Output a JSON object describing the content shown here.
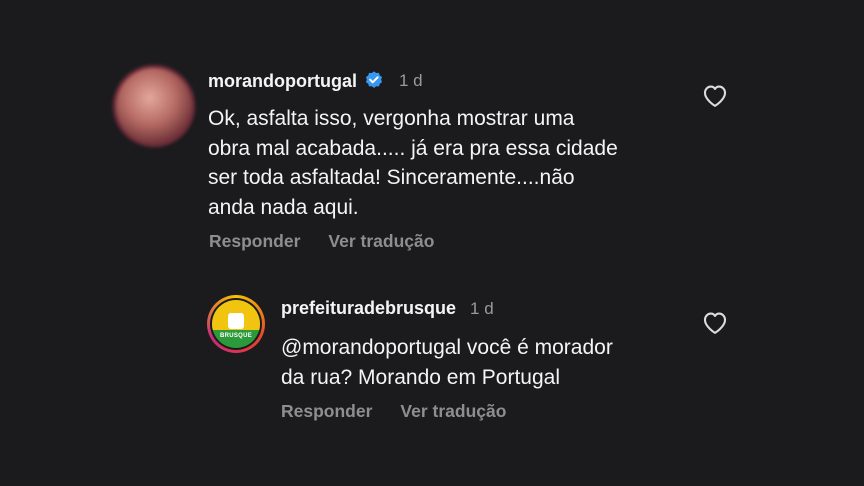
{
  "comments": [
    {
      "username": "morandoportugal",
      "verified": true,
      "time": "1 d",
      "text": "Ok, asfalta isso, vergonha mostrar uma\nobra mal acabada..... já era pra essa cidade\nser toda asfaltada! Sinceramente....não\nanda nada aqui.",
      "reply_label": "Responder",
      "translate_label": "Ver tradução"
    }
  ],
  "replies": [
    {
      "username": "prefeituradebrusque",
      "time": "1 d",
      "avatar_text": "BRUSQUE",
      "text": "@morandoportugal você é morador\nda rua? Morando em Portugal",
      "reply_label": "Responder",
      "translate_label": "Ver tradução"
    }
  ],
  "colors": {
    "background": "#1b1b1d",
    "text": "#f4f4f4",
    "muted": "#8e8e8e",
    "verified": "#3897f0"
  },
  "icons": {
    "like": "heart-outline-icon",
    "verified": "verified-badge-icon"
  }
}
